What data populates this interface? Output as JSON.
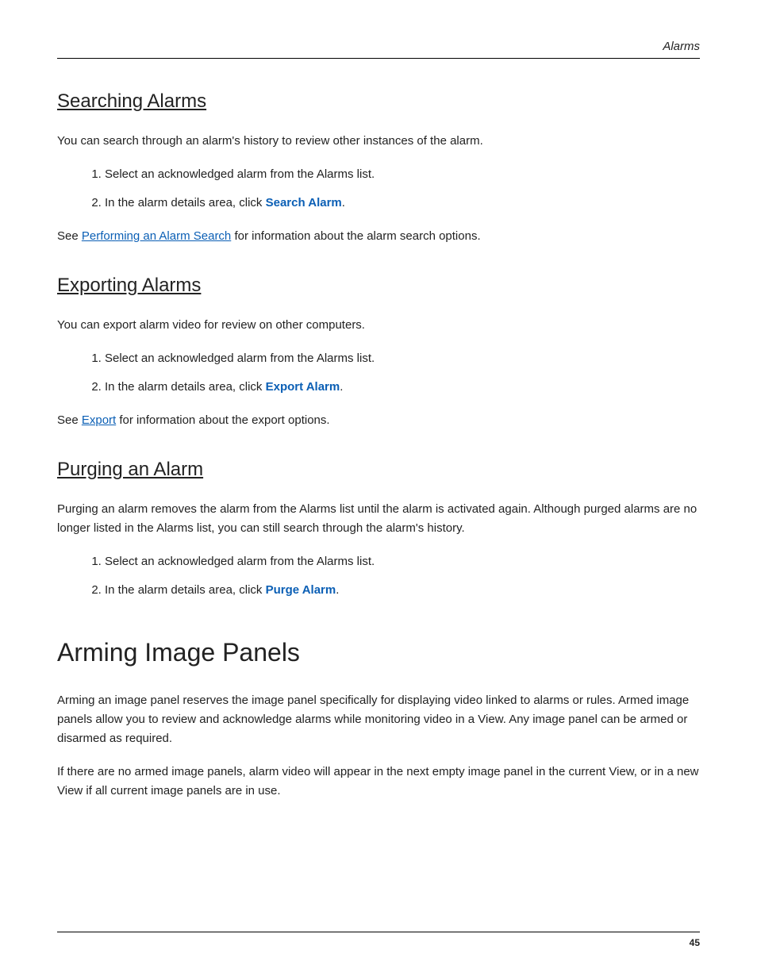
{
  "header": {
    "section_label": "Alarms"
  },
  "sections": {
    "searching": {
      "heading": "Searching Alarms",
      "intro": "You can search through an alarm's history to review other instances of the alarm.",
      "step1": "Select an acknowledged alarm from the Alarms list.",
      "step2_prefix": "In the alarm details area, click ",
      "step2_action": "Search Alarm",
      "step2_suffix": ".",
      "see_prefix": "See ",
      "see_link": "Performing an Alarm Search",
      "see_suffix": " for information about the alarm search options."
    },
    "exporting": {
      "heading": "Exporting Alarms",
      "intro": "You can export alarm video for review on other computers.",
      "step1": "Select an acknowledged alarm from the Alarms list.",
      "step2_prefix": "In the alarm details area, click ",
      "step2_action": "Export Alarm",
      "step2_suffix": ".",
      "see_prefix": "See ",
      "see_link": "Export",
      "see_suffix": " for information about the export options."
    },
    "purging": {
      "heading": "Purging an Alarm",
      "intro": "Purging an alarm removes the alarm from the Alarms list until the alarm is activated again. Although purged alarms are no longer listed in the Alarms list, you can still search through the alarm's history.",
      "step1": "Select an acknowledged alarm from the Alarms list.",
      "step2_prefix": "In the alarm details area, click ",
      "step2_action": "Purge Alarm",
      "step2_suffix": "."
    },
    "arming": {
      "heading": "Arming Image Panels",
      "para1": "Arming an image panel reserves the image panel specifically for displaying video linked to alarms or rules. Armed image panels allow you to review and acknowledge alarms while monitoring video in a View. Any image panel can be armed or disarmed as required.",
      "para2": "If there are no armed image panels, alarm video will appear in the next empty image panel in the current View, or in a new View if all current image panels are in use."
    }
  },
  "footer": {
    "page_number": "45"
  }
}
